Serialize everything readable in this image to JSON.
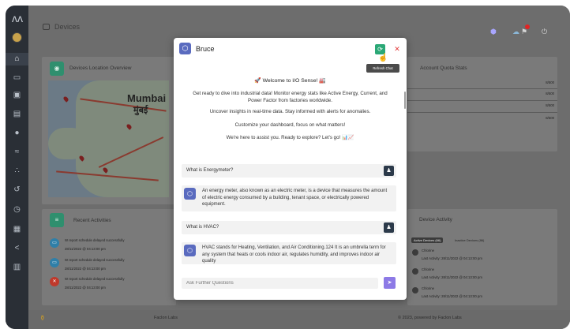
{
  "sidebar": {
    "icons": [
      "logo-icon",
      "avatar",
      "home-icon",
      "desktop-icon",
      "contacts-icon",
      "list-icon",
      "bell-icon",
      "activity-icon",
      "network-icon",
      "history-icon",
      "clock-icon",
      "grid-icon",
      "share-icon",
      "book-icon"
    ]
  },
  "header": {
    "title": "Devices"
  },
  "cards": {
    "location": {
      "title": "Devices Location Overview",
      "map_label_en": "Mumbai",
      "map_label_local": "मुंबई"
    },
    "quota": {
      "title": "Account Quota Stats",
      "values": [
        "8/500",
        "8/500",
        "8/500",
        "8/500"
      ]
    },
    "recent": {
      "title": "Recent Activities",
      "items": [
        {
          "text": "W report schedule delayed successfully",
          "time": "28/11/2022 @ 04:13:00 pm"
        },
        {
          "text": "W report schedule delayed successfully",
          "time": "28/11/2022 @ 04:13:00 pm"
        },
        {
          "text": "W report schedule delayed successfully",
          "time": "28/11/2022 @ 04:13:00 pm"
        }
      ]
    },
    "device_activity": {
      "title": "Device Activity",
      "tabs": [
        "Active Devices (66)",
        "Inactive Devices (86)"
      ],
      "items": [
        {
          "name": "Chlorine",
          "status": "Last Activity: 28/11/2022 @ 04:13:00 pm"
        },
        {
          "name": "Chlorine",
          "status": "Last Activity: 28/11/2022 @ 04:13:00 pm"
        },
        {
          "name": "Chlorine",
          "status": "Last Activity: 28/11/2022 @ 04:13:00 pm"
        }
      ]
    }
  },
  "footer": {
    "left": "Faclon Labs",
    "right": "© 2023, powered by Faclon Labs"
  },
  "chat": {
    "title": "Bruce",
    "tooltip": "Refresh Chat",
    "welcome": {
      "heading": "🚀 Welcome to I/O Sense! 🏭",
      "p1": "Get ready to dive into industrial data! Monitor energy stats like Active Energy, Current, and Power Factor from factories worldwide.",
      "p2": "Uncover insights in real-time data. Stay informed with alerts for anomalies.",
      "p3": "Customize your dashboard, focus on what matters!",
      "p4": "We're here to assist you. Ready to explore? Let's go! 📊📈"
    },
    "q1": "What is Energymeter?",
    "a1": "An energy meter, also known as an electric meter, is a device that measures the amount of electric energy consumed by a building, tenant space, or electrically powered equipment.",
    "q2": "What is HVAC?",
    "a2": "HVAC stands for Heating, Ventilation, and Air Conditioning.124 It is an umbrella term for any system that heats or cools indoor air, regulates humidity, and improves indoor air quality",
    "input_placeholder": "Ask Further Questions"
  },
  "colors": {
    "accent": "#2f8f6e",
    "chat_brand": "#5a6bbf",
    "send": "#8d7ae6",
    "refresh": "#2aa876",
    "close": "#e33b3b"
  }
}
